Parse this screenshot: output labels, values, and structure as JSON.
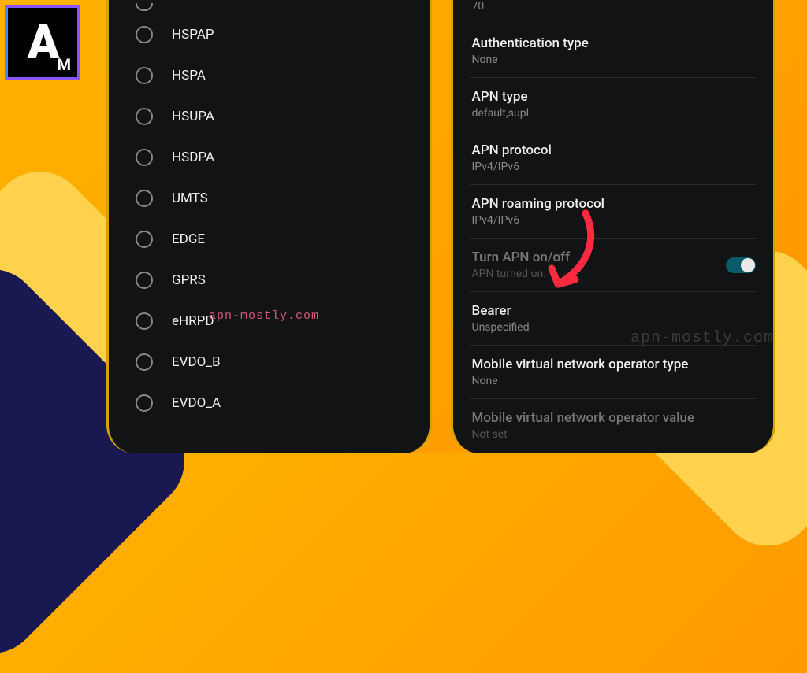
{
  "logo": {
    "primary": "A",
    "secondary": "M"
  },
  "watermarks": {
    "left": "apn-mostly.com",
    "right": "apn-mostly.com"
  },
  "left_panel": {
    "radio_options": [
      "HSPAP",
      "HSPA",
      "HSUPA",
      "HSDPA",
      "UMTS",
      "EDGE",
      "GPRS",
      "eHRPD",
      "EVDO_B",
      "EVDO_A"
    ]
  },
  "right_panel": {
    "top_partial_value": "70",
    "rows": [
      {
        "title": "Authentication type",
        "value": "None",
        "disabled": false
      },
      {
        "title": "APN type",
        "value": "default,supl",
        "disabled": false
      },
      {
        "title": "APN protocol",
        "value": "IPv4/IPv6",
        "disabled": false
      },
      {
        "title": "APN roaming protocol",
        "value": "IPv4/IPv6",
        "disabled": false
      },
      {
        "title": "Turn APN on/off",
        "value": "APN turned on.",
        "disabled": true,
        "toggle": true,
        "toggle_on": true
      },
      {
        "title": "Bearer",
        "value": "Unspecified",
        "disabled": false
      },
      {
        "title": "Mobile virtual network operator type",
        "value": "None",
        "disabled": false
      },
      {
        "title": "Mobile virtual network operator value",
        "value": "Not set",
        "disabled": true
      }
    ]
  }
}
